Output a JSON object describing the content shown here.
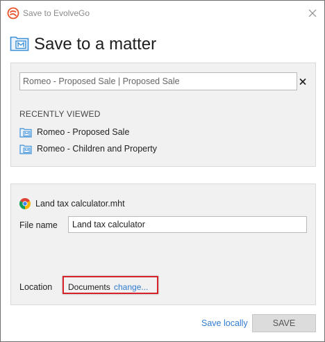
{
  "window": {
    "title": "Save to EvolveGo"
  },
  "heading": {
    "title": "Save to a matter"
  },
  "matter_search": {
    "value": "Romeo - Proposed Sale | Proposed Sale"
  },
  "recently_viewed": {
    "label": "RECENTLY VIEWED",
    "items": [
      {
        "label": "Romeo - Proposed Sale"
      },
      {
        "label": "Romeo - Children and Property"
      }
    ]
  },
  "file": {
    "source_name": "Land tax calculator.mht",
    "name_label": "File name",
    "name_value": "Land tax calculator",
    "location_label": "Location",
    "location_value": "Documents",
    "change_label": "change..."
  },
  "footer": {
    "save_locally_label": "Save locally",
    "save_label": "SAVE"
  },
  "icons": {
    "app": "evolvego-logo-icon",
    "close": "close-icon",
    "matter": "matter-folder-icon",
    "clear": "clear-x-icon",
    "browser": "chrome-icon"
  },
  "colors": {
    "accent_link": "#2f7bd0",
    "app_logo": "#e8542a",
    "highlight_border": "#d6232b",
    "matter_icon": "#3b8fd6",
    "panel_bg": "#f1f1f1"
  }
}
